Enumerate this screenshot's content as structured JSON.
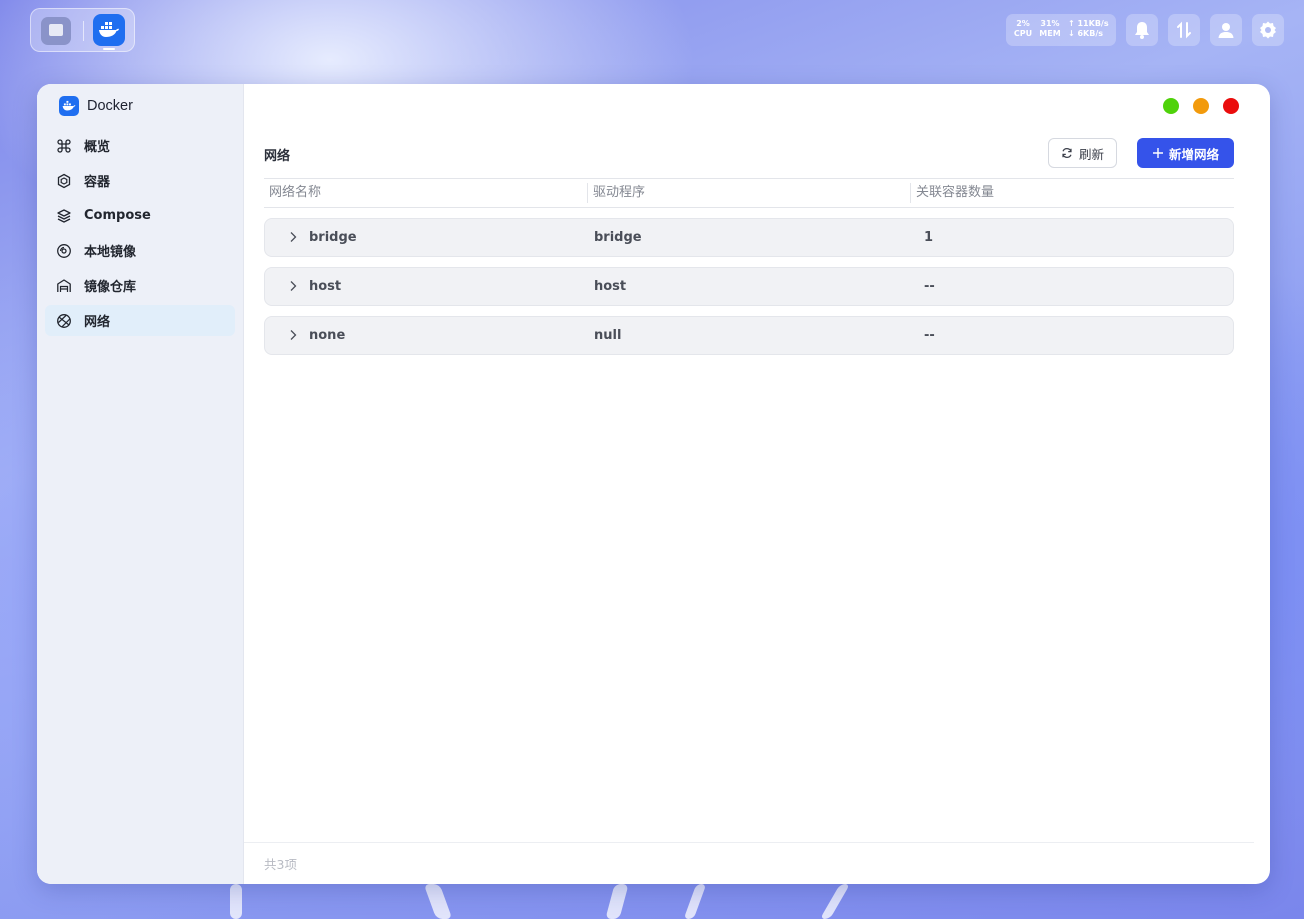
{
  "topbar": {
    "stats": {
      "cpu_value": "2%",
      "cpu_label": "CPU",
      "mem_value": "31%",
      "mem_label": "MEM",
      "net_up": "↑ 11KB/s",
      "net_down": "↓ 6KB/s"
    },
    "icons": [
      "bell-icon",
      "transfer-icon",
      "user-icon",
      "gear-icon"
    ]
  },
  "app": {
    "title": "Docker"
  },
  "sidebar": {
    "items": [
      {
        "label": "概览",
        "icon": "command-icon",
        "active": false
      },
      {
        "label": "容器",
        "icon": "hexagon-icon",
        "active": false
      },
      {
        "label": "Compose",
        "icon": "layers-icon",
        "active": false
      },
      {
        "label": "本地镜像",
        "icon": "disc-icon",
        "active": false
      },
      {
        "label": "镜像仓库",
        "icon": "warehouse-icon",
        "active": false
      },
      {
        "label": "网络",
        "icon": "network-icon",
        "active": true
      }
    ]
  },
  "window_controls": {
    "colors": [
      "#4fd20a",
      "#f29a0c",
      "#ea0d0d"
    ]
  },
  "main": {
    "title": "网络",
    "refresh_label": "刷新",
    "add_label": "新增网络",
    "columns": [
      "网络名称",
      "驱动程序",
      "关联容器数量"
    ],
    "rows": [
      {
        "name": "bridge",
        "driver": "bridge",
        "count": "1"
      },
      {
        "name": "host",
        "driver": "host",
        "count": "--"
      },
      {
        "name": "none",
        "driver": "null",
        "count": "--"
      }
    ],
    "footer": "共3项"
  },
  "colors": {
    "accent": "#3553ea",
    "docker_blue": "#1f6ef0"
  }
}
